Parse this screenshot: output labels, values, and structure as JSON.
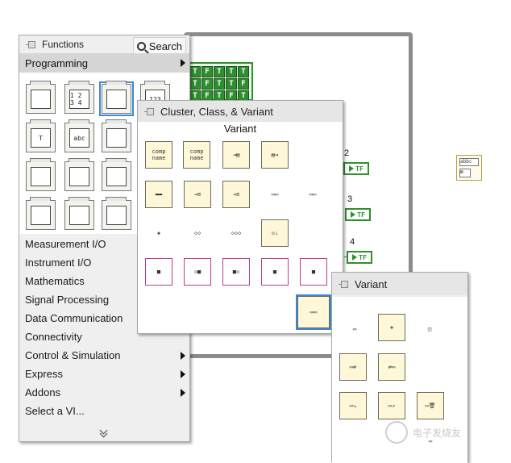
{
  "functions_palette": {
    "title": "Functions",
    "search_label": "Search",
    "programming_label": "Programming",
    "icon_names": [
      "structures-icon",
      "array-icon",
      "cluster-class-variant-icon",
      "numeric-icon",
      "boolean-icon",
      "string-icon",
      "comparison-icon",
      "timing-icon",
      "dialog-ui-icon",
      "file-io-icon",
      "waveform-icon",
      "application-control-icon",
      "synchronization-icon",
      "graphics-sound-icon",
      "report-generation-icon"
    ],
    "icon_glyphs": [
      "",
      "1 2\n3 4",
      "",
      "123",
      "T",
      "abc",
      "",
      "",
      "",
      "",
      "",
      "",
      "",
      "",
      ""
    ],
    "categories": [
      {
        "label": "Measurement I/O",
        "has_submenu": false
      },
      {
        "label": "Instrument I/O",
        "has_submenu": false
      },
      {
        "label": "Mathematics",
        "has_submenu": false
      },
      {
        "label": "Signal Processing",
        "has_submenu": false
      },
      {
        "label": "Data Communication",
        "has_submenu": false
      },
      {
        "label": "Connectivity",
        "has_submenu": false
      },
      {
        "label": "Control & Simulation",
        "has_submenu": true
      },
      {
        "label": "Express",
        "has_submenu": true
      },
      {
        "label": "Addons",
        "has_submenu": true
      },
      {
        "label": "Select a VI...",
        "has_submenu": false
      }
    ]
  },
  "cluster_palette": {
    "title": "Cluster, Class, & Variant",
    "subtitle": "Variant"
  },
  "variant_palette": {
    "title": "Variant"
  },
  "block_diagram": {
    "bool_values": [
      "T",
      "F",
      "T",
      "T",
      "T",
      "T",
      "F",
      "T",
      "T",
      "F",
      "T",
      "F",
      "T",
      "F",
      "T"
    ],
    "labels": [
      "2",
      "3",
      "4"
    ],
    "indicator_text": "TF"
  },
  "watermark": "电子发烧友"
}
